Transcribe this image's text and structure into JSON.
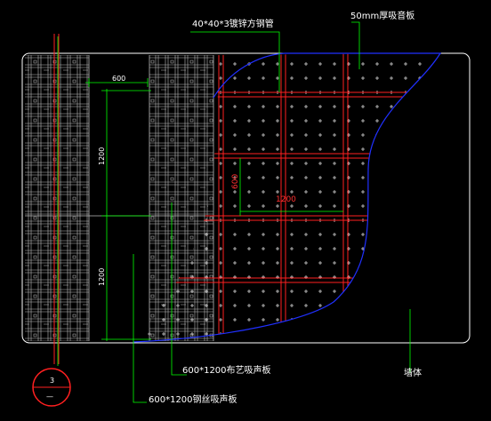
{
  "labels": {
    "steel_tube": "40*40*3镀锌方钢管",
    "board_50mm": "50mm厚吸音板",
    "panel_a": "600*1200布艺吸声板",
    "panel_b": "600*1200钢丝吸声板",
    "wall": "墙体"
  },
  "dimensions": {
    "top_width": "600",
    "height_upper": "1200",
    "height_lower": "1200",
    "grid_h": "1200",
    "grid_v": "600"
  },
  "section_marker": {
    "number": "3",
    "sub": "—"
  },
  "colors": {
    "background": "#000000",
    "frame": "#ffffff",
    "grid": "#c8c8c8",
    "red": "#ff2020",
    "green": "#00ff00",
    "blue": "#2030ff"
  }
}
